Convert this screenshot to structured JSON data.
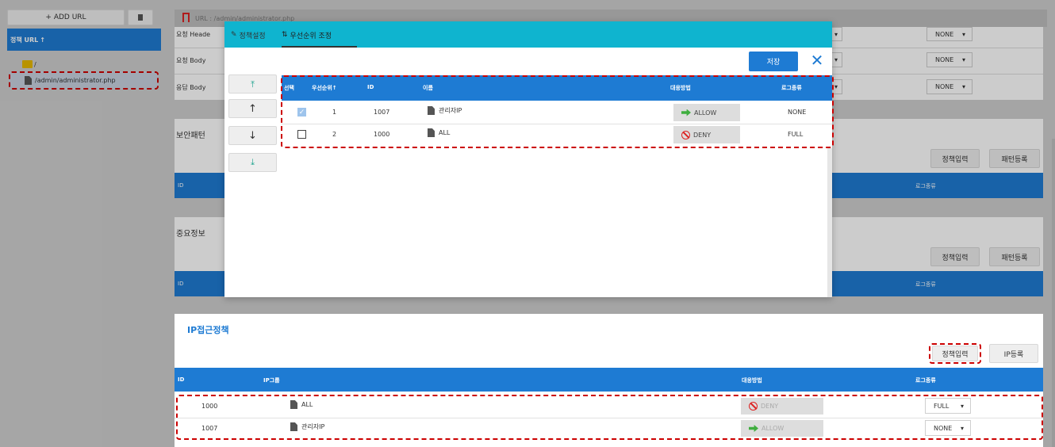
{
  "left": {
    "add_url_label": "+ ADD URL",
    "delete_icon": "trash-icon",
    "tree_header": "정책 URL",
    "tree_sort": "↑",
    "folder_label": "/",
    "file_label": "/admin/administrator.php"
  },
  "bg": {
    "url_bar": "URL : /admin/administrator.php",
    "req_header": "요청 Heade",
    "req_body": "요청 Body ",
    "resp_body": "응답 Body ",
    "none1": "NONE",
    "none2": "NONE",
    "none3": "NONE",
    "sec_pattern_title": "보안패턴",
    "important_title": "중요정보",
    "policy_input": "정책입력",
    "pattern_register": "패턴등록",
    "id_col": "ID",
    "log_col": "로그종류"
  },
  "ip": {
    "title": "IP접근정책",
    "policy_input": "정책입력",
    "ip_register": "IP등록",
    "columns": {
      "id": "ID",
      "group": "IP그룹",
      "action": "대응방법",
      "log": "로그종류"
    },
    "rows": [
      {
        "id": "1000",
        "name": "ALL",
        "action": "DENY",
        "log": "FULL"
      },
      {
        "id": "1007",
        "name": "관리자IP",
        "action": "ALLOW",
        "log": "NONE"
      }
    ]
  },
  "modal": {
    "tab1": "정책설정",
    "tab2": "우선순위 조정",
    "save": "저장",
    "columns": {
      "select": "선택",
      "priority": "우선순위",
      "priority_sort": "↑",
      "id": "ID",
      "name": "이름",
      "action": "대응방법",
      "log": "로그종류"
    },
    "rows": [
      {
        "checked": true,
        "priority": "1",
        "id": "1007",
        "name": "관리자IP",
        "action": "ALLOW",
        "log": "NONE"
      },
      {
        "checked": false,
        "priority": "2",
        "id": "1000",
        "name": "ALL",
        "action": "DENY",
        "log": "FULL"
      }
    ],
    "move_buttons": [
      "move-top-icon",
      "move-up-icon",
      "move-down-icon",
      "move-bottom-icon"
    ]
  },
  "colors": {
    "accent": "#1e7bd3",
    "tab_bar": "#0fb4cf",
    "deny": "#d22222",
    "allow": "#3fae3f"
  }
}
